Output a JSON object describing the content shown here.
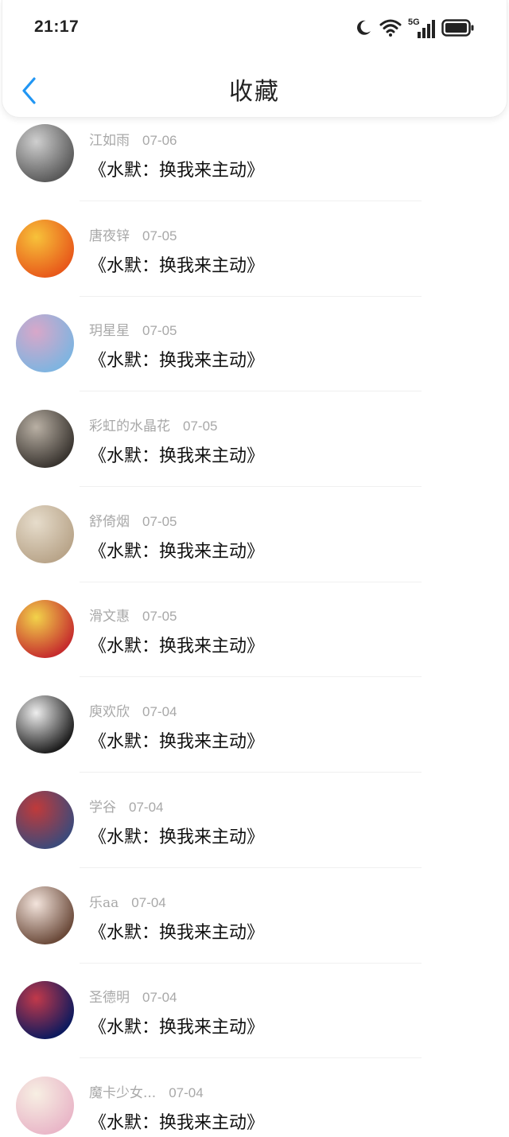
{
  "status_bar": {
    "time": "21:17",
    "network": "5G",
    "icons": [
      "moon-icon",
      "wifi-icon",
      "signal-icon",
      "battery-icon"
    ]
  },
  "header": {
    "title": "收藏",
    "back_icon": "chevron-left-icon",
    "accent_color": "#2196F3"
  },
  "items": [
    {
      "name": "江如雨",
      "date": "07-06",
      "title": "《水默：换我来主动》",
      "avatar": [
        "#5a5a5a",
        "#cfcfcf"
      ]
    },
    {
      "name": "唐夜锌",
      "date": "07-05",
      "title": "《水默：换我来主动》",
      "avatar": [
        "#e8591a",
        "#f7c23a"
      ]
    },
    {
      "name": "玥星星",
      "date": "07-05",
      "title": "《水默：换我来主动》",
      "avatar": [
        "#7fb4e0",
        "#d8a7c9"
      ]
    },
    {
      "name": "彩虹的水晶花",
      "date": "07-05",
      "title": "《水默：换我来主动》",
      "avatar": [
        "#3a3530",
        "#b9b0a4"
      ]
    },
    {
      "name": "舒倚烟",
      "date": "07-05",
      "title": "《水默：换我来主动》",
      "avatar": [
        "#b9a58a",
        "#e6dccb"
      ]
    },
    {
      "name": "滑文惠",
      "date": "07-05",
      "title": "《水默：换我来主动》",
      "avatar": [
        "#c62d2d",
        "#f2d34a"
      ]
    },
    {
      "name": "庾欢欣",
      "date": "07-04",
      "title": "《水默：换我来主动》",
      "avatar": [
        "#1e1e1e",
        "#eeeeee"
      ]
    },
    {
      "name": "学谷",
      "date": "07-04",
      "title": "《水默：换我来主动》",
      "avatar": [
        "#3d4a7a",
        "#c03a3a"
      ]
    },
    {
      "name": "乐aa",
      "date": "07-04",
      "title": "《水默：换我来主动》",
      "avatar": [
        "#6b4a3a",
        "#f3e4dc"
      ]
    },
    {
      "name": "圣德明",
      "date": "07-04",
      "title": "《水默：换我来主动》",
      "avatar": [
        "#0e1a5e",
        "#c2394a"
      ]
    },
    {
      "name": "魔卡少女...",
      "date": "07-04",
      "title": "《水默：换我来主动》",
      "avatar": [
        "#e9b7c8",
        "#f7efe3"
      ]
    }
  ]
}
